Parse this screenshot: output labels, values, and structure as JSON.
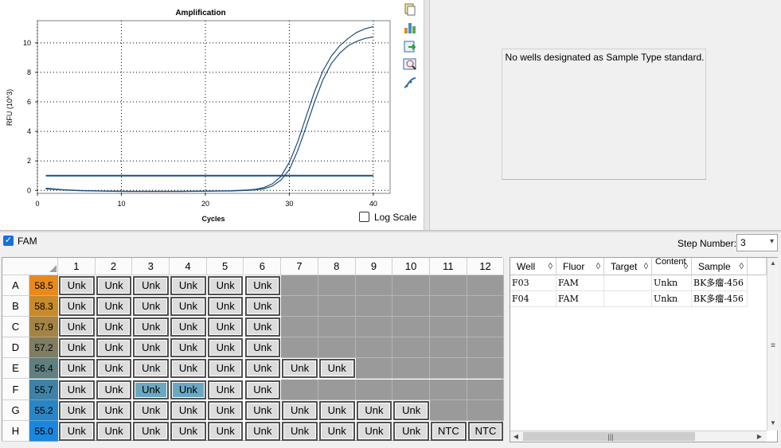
{
  "chart": {
    "title": "Amplification",
    "ylabel": "RFU (10^3)",
    "xlabel": "Cycles",
    "log_scale_label": "Log Scale",
    "y_ticks": [
      "0",
      "2",
      "4",
      "6",
      "8",
      "10"
    ],
    "x_ticks": [
      "0",
      "10",
      "20",
      "30",
      "40"
    ]
  },
  "chart_data": {
    "type": "line",
    "title": "Amplification",
    "xlabel": "Cycles",
    "ylabel": "RFU (10^3)",
    "xlim": [
      0,
      42
    ],
    "ylim": [
      -0.2,
      11.5
    ],
    "grid": true,
    "threshold": 1.0,
    "x": [
      1,
      3,
      5,
      7,
      9,
      11,
      13,
      15,
      17,
      19,
      21,
      23,
      25,
      26,
      27,
      28,
      29,
      30,
      31,
      32,
      33,
      34,
      35,
      36,
      37,
      38,
      39,
      40
    ],
    "series": [
      {
        "values": [
          0.15,
          0.05,
          0.0,
          -0.03,
          -0.05,
          -0.06,
          -0.06,
          -0.06,
          -0.06,
          -0.05,
          -0.04,
          -0.02,
          0.03,
          0.08,
          0.2,
          0.45,
          0.95,
          1.9,
          3.3,
          5.0,
          6.7,
          8.1,
          9.1,
          9.8,
          10.3,
          10.7,
          10.95,
          11.1
        ]
      },
      {
        "values": [
          0.1,
          0.03,
          -0.02,
          -0.04,
          -0.06,
          -0.07,
          -0.07,
          -0.07,
          -0.07,
          -0.06,
          -0.05,
          -0.04,
          0.0,
          0.04,
          0.12,
          0.3,
          0.7,
          1.4,
          2.7,
          4.3,
          6.0,
          7.5,
          8.6,
          9.3,
          9.8,
          10.1,
          10.3,
          10.4
        ]
      }
    ]
  },
  "standard_panel": {
    "message": "No wells designated as Sample Type standard."
  },
  "fluor_bar": {
    "fam_label": "FAM",
    "fam_checked": true,
    "step_label": "Step Number:",
    "step_value": "3"
  },
  "plate": {
    "columns": [
      "1",
      "2",
      "3",
      "4",
      "5",
      "6",
      "7",
      "8",
      "9",
      "10",
      "11",
      "12"
    ],
    "rows": [
      {
        "label": "A",
        "temp": "58.5",
        "color": "#e88a1a",
        "wells": [
          "Unk",
          "Unk",
          "Unk",
          "Unk",
          "Unk",
          "Unk",
          "",
          "",
          "",
          "",
          "",
          ""
        ]
      },
      {
        "label": "B",
        "temp": "58.3",
        "color": "#c98a2a",
        "wells": [
          "Unk",
          "Unk",
          "Unk",
          "Unk",
          "Unk",
          "Unk",
          "",
          "",
          "",
          "",
          "",
          ""
        ]
      },
      {
        "label": "C",
        "temp": "57.9",
        "color": "#a48446",
        "wells": [
          "Unk",
          "Unk",
          "Unk",
          "Unk",
          "Unk",
          "Unk",
          "",
          "",
          "",
          "",
          "",
          ""
        ]
      },
      {
        "label": "D",
        "temp": "57.2",
        "color": "#7f7d62",
        "wells": [
          "Unk",
          "Unk",
          "Unk",
          "Unk",
          "Unk",
          "Unk",
          "",
          "",
          "",
          "",
          "",
          ""
        ]
      },
      {
        "label": "E",
        "temp": "56.4",
        "color": "#5f7f80",
        "wells": [
          "Unk",
          "Unk",
          "Unk",
          "Unk",
          "Unk",
          "Unk",
          "Unk",
          "Unk",
          "",
          "",
          "",
          ""
        ]
      },
      {
        "label": "F",
        "temp": "55.7",
        "color": "#3f82a6",
        "wells": [
          "Unk",
          "Unk",
          "Unk",
          "Unk",
          "Unk",
          "Unk",
          "",
          "",
          "",
          "",
          "",
          ""
        ]
      },
      {
        "label": "G",
        "temp": "55.2",
        "color": "#2a85c4",
        "wells": [
          "Unk",
          "Unk",
          "Unk",
          "Unk",
          "Unk",
          "Unk",
          "Unk",
          "Unk",
          "Unk",
          "Unk",
          "",
          ""
        ]
      },
      {
        "label": "H",
        "temp": "55.0",
        "color": "#1b86de",
        "wells": [
          "Unk",
          "Unk",
          "Unk",
          "Unk",
          "Unk",
          "Unk",
          "Unk",
          "Unk",
          "Unk",
          "Unk",
          "NTC",
          "NTC"
        ]
      }
    ],
    "selected_wells": [
      "F3",
      "F4"
    ]
  },
  "well_table": {
    "columns": [
      "Well",
      "Fluor",
      "Target",
      "Content",
      "Sample"
    ],
    "rows": [
      {
        "well": "F03",
        "fluor": "FAM",
        "target": "",
        "content": "Unkn",
        "sample": "BK多瘤-456"
      },
      {
        "well": "F04",
        "fluor": "FAM",
        "target": "",
        "content": "Unkn",
        "sample": "BK多瘤-456"
      }
    ]
  },
  "icons": [
    "copy-icon",
    "bar-chart-icon",
    "export-icon",
    "zoom-icon",
    "curve-icon",
    "checkbox-icon",
    "sort-icon",
    "chevron-down-icon"
  ]
}
